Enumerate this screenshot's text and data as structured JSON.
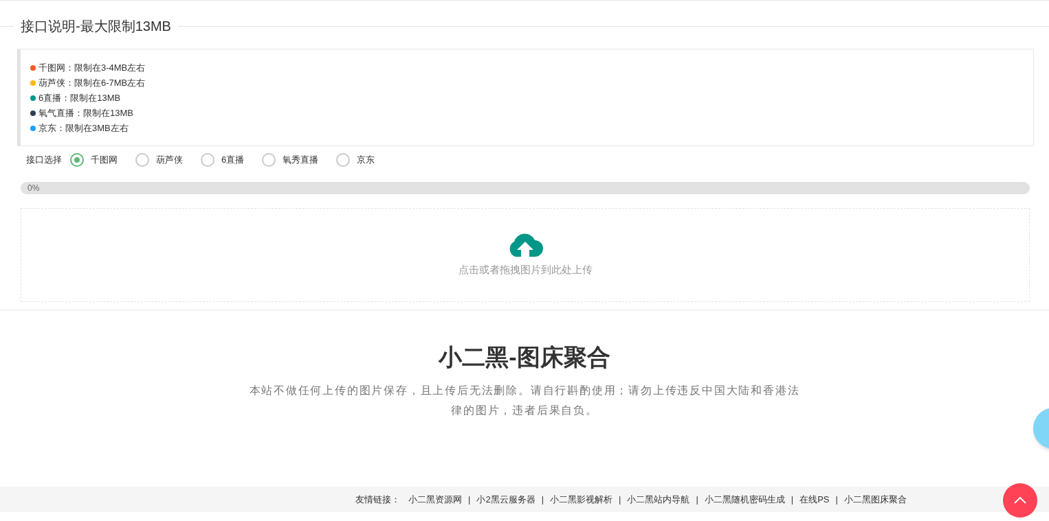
{
  "section_title": "接口说明-最大限制13MB",
  "limits": [
    {
      "text": "千图网：限制在3-4MB左右",
      "color": "#ff5722"
    },
    {
      "text": "葫芦侠：限制在6-7MB左右",
      "color": "#ffb800"
    },
    {
      "text": "6直播：限制在13MB",
      "color": "#009688"
    },
    {
      "text": "氧气直播：限制在13MB",
      "color": "#2f4056"
    },
    {
      "text": "京东：限制在3MB左右",
      "color": "#1e9fff"
    }
  ],
  "interface_select": {
    "label": "接口选择",
    "options": [
      {
        "label": "千图网",
        "selected": true
      },
      {
        "label": "葫芦侠",
        "selected": false
      },
      {
        "label": "6直播",
        "selected": false
      },
      {
        "label": "氧秀直播",
        "selected": false
      },
      {
        "label": "京东",
        "selected": false
      }
    ]
  },
  "progress": {
    "level": 0,
    "reading": "0%"
  },
  "upload": {
    "hint": "点击或者拖拽图片到此处上传"
  },
  "hero": {
    "title": "小二黑-图床聚合",
    "notice": "本站不做任何上传的图片保存，且上传后无法删除。请自行斟酌使用；请勿上传违反中国大陆和香港法律的图片，违者后果自负。"
  },
  "footer": {
    "label": "友情链接：",
    "links": [
      "小二黑资源网",
      "小2黑云服务器",
      "小二黑影视解析",
      "小二黑站内导航",
      "小二黑随机密码生成",
      "在线PS",
      "小二黑图床聚合"
    ],
    "separator": "|"
  }
}
